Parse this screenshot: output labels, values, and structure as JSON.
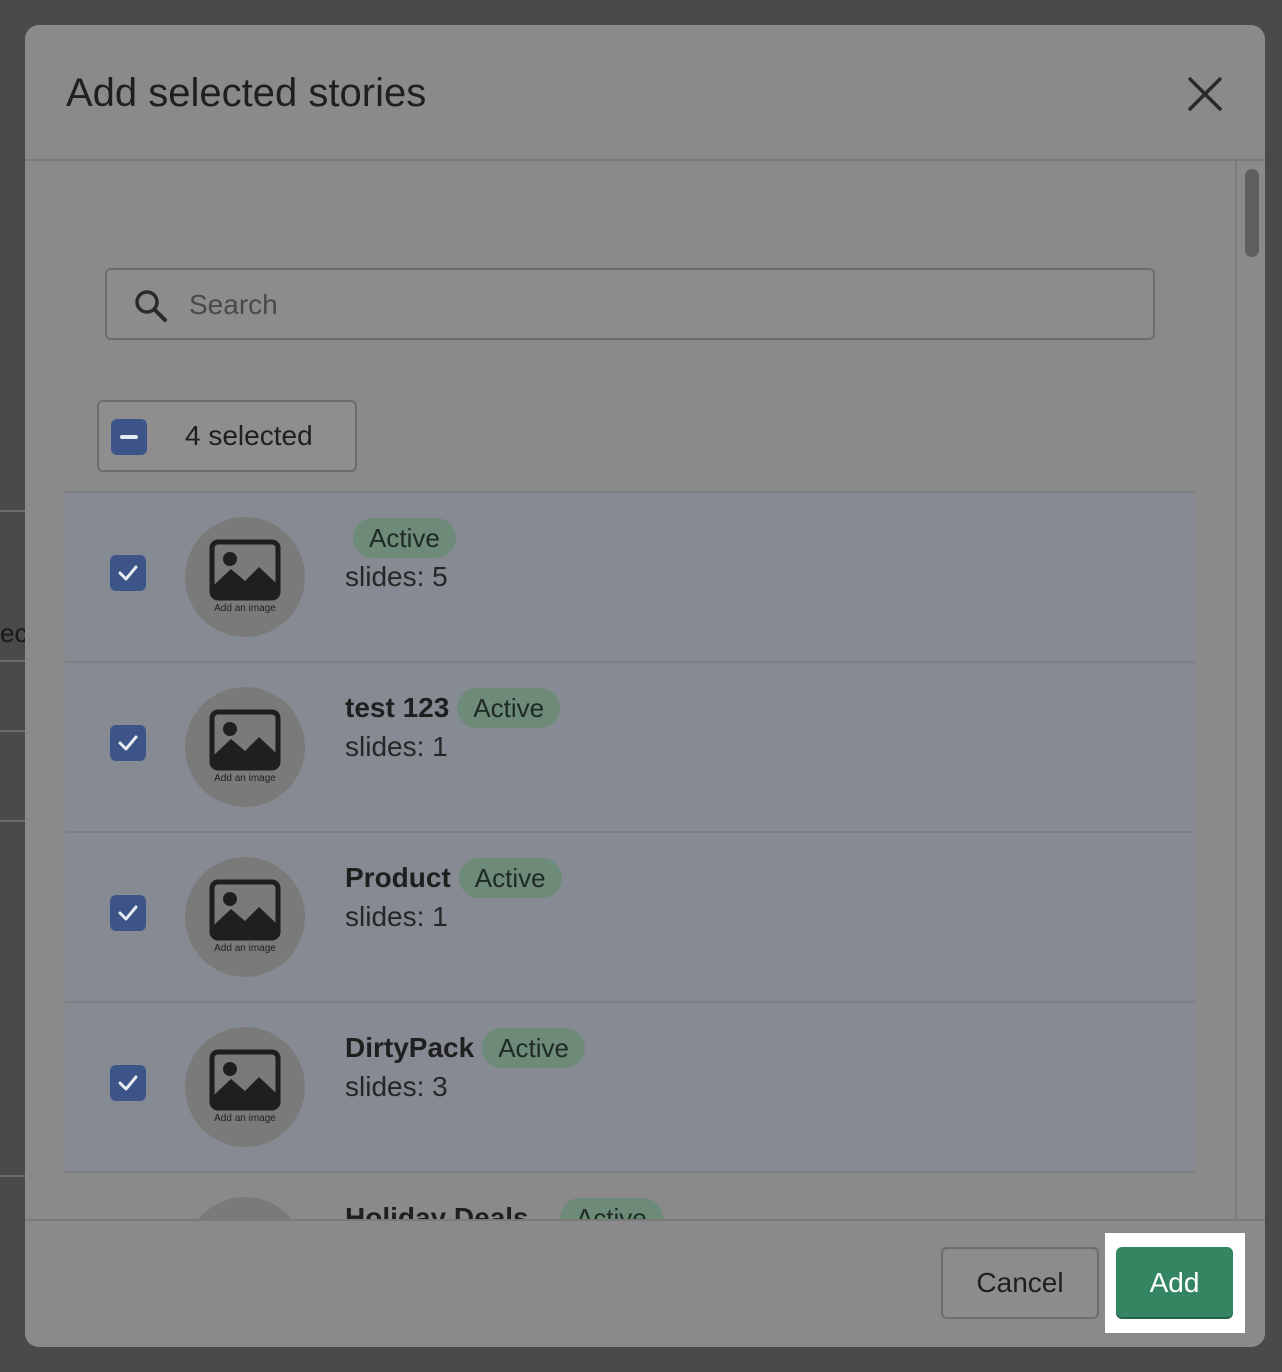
{
  "background": {
    "fragment_text": "ec"
  },
  "modal": {
    "title": "Add selected stories",
    "close_label": "×"
  },
  "search": {
    "placeholder": "Search",
    "value": ""
  },
  "bulk": {
    "label": "4 selected",
    "state": "indeterminate"
  },
  "stories": [
    {
      "name": "",
      "status": "Active",
      "slides": "slides: 5",
      "checked": true,
      "thumb_caption": "Add an image"
    },
    {
      "name": "test 123",
      "status": "Active",
      "slides": "slides: 1",
      "checked": true,
      "thumb_caption": "Add an image"
    },
    {
      "name": "Product",
      "status": "Active",
      "slides": "slides: 1",
      "checked": true,
      "thumb_caption": "Add an image"
    },
    {
      "name": "DirtyPack",
      "status": "Active",
      "slides": "slides: 3",
      "checked": true,
      "thumb_caption": "Add an image"
    },
    {
      "name": "Holiday Deals...",
      "status": "Active",
      "slides": "",
      "checked": false,
      "thumb_caption": ""
    }
  ],
  "footer": {
    "cancel_label": "Cancel",
    "add_label": "Add"
  },
  "colors": {
    "overlay": "#4a4a4b",
    "checkbox": "#3d5488",
    "badge": "#6e8a79",
    "primary_button": "#348561"
  }
}
